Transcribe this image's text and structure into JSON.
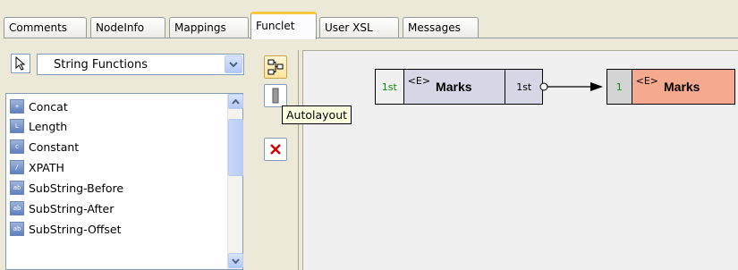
{
  "tabs": [
    {
      "label": "Comments"
    },
    {
      "label": "NodeInfo"
    },
    {
      "label": "Mappings"
    },
    {
      "label": "Funclet",
      "active": true
    },
    {
      "label": "User XSL"
    },
    {
      "label": "Messages"
    }
  ],
  "function_category": {
    "selected": "String Functions"
  },
  "functions": [
    {
      "label": "Concat",
      "icon": "concat-icon"
    },
    {
      "label": "Length",
      "icon": "length-icon"
    },
    {
      "label": "Constant",
      "icon": "constant-icon"
    },
    {
      "label": "XPATH",
      "icon": "xpath-icon"
    },
    {
      "label": "SubString-Before",
      "icon": "substring-before-icon"
    },
    {
      "label": "SubString-After",
      "icon": "substring-after-icon"
    },
    {
      "label": "SubString-Offset",
      "icon": "substring-offset-icon"
    }
  ],
  "toolbar": {
    "autolayout_tooltip": "Autolayout"
  },
  "canvas": {
    "source_node": {
      "left_ord": "1st",
      "tag": "<E>",
      "name": "Marks",
      "right_ord": "1st",
      "color": "#d6d6e6"
    },
    "target_node": {
      "left_ord": "1",
      "tag": "<E>",
      "name": "Marks",
      "color": "#f5a98e"
    }
  }
}
